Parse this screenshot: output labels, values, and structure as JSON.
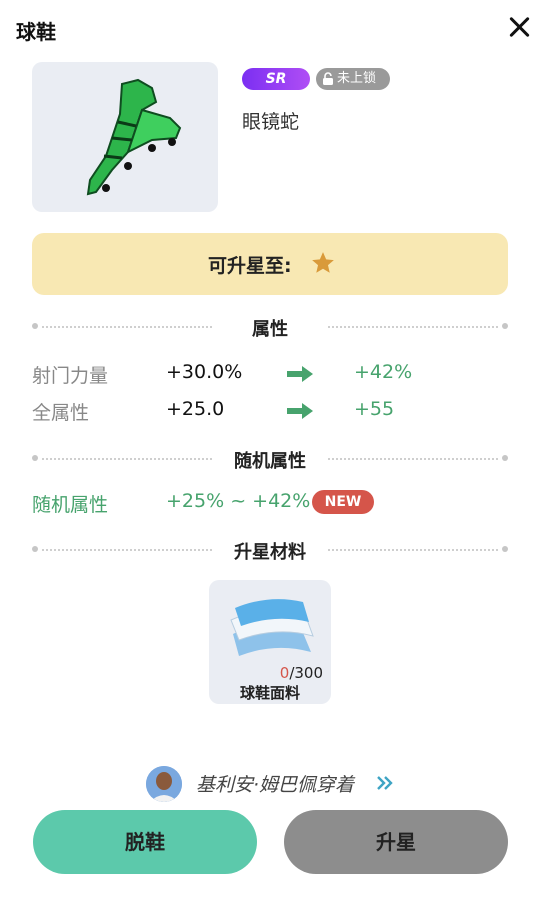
{
  "window": {
    "title": "球鞋"
  },
  "item": {
    "rarity": "SR",
    "lock_status": "未上锁",
    "name": "眼镜蛇"
  },
  "upgrade": {
    "label": "可升星至:"
  },
  "sections": {
    "attributes": "属性",
    "random_attributes": "随机属性",
    "materials": "升星材料"
  },
  "attributes": [
    {
      "name": "射门力量",
      "from": "+30.0%",
      "to": "+42%"
    },
    {
      "name": "全属性",
      "from": "+25.0",
      "to": "+55"
    }
  ],
  "random_attribute": {
    "name": "随机属性",
    "range": "+25% ~ +42%",
    "badge": "NEW"
  },
  "material": {
    "count": "0",
    "total": "/300",
    "name": "球鞋面料"
  },
  "wearer": {
    "text": "基利安·姆巴佩穿着"
  },
  "buttons": {
    "remove": "脱鞋",
    "upgrade": "升星"
  },
  "colors": {
    "green": "#47a36d",
    "banner": "#f8e8b3",
    "remove_button": "#5cc9ab",
    "upgrade_button": "#8d8d8d",
    "badge_red": "#d5554a",
    "sr_purple": "#8a38f4"
  },
  "icons": [
    "close-icon",
    "boot-icon",
    "unlock-icon",
    "star-icon",
    "arrow-right-icon",
    "fabric-icon",
    "avatar-icon",
    "double-chevron-icon"
  ]
}
